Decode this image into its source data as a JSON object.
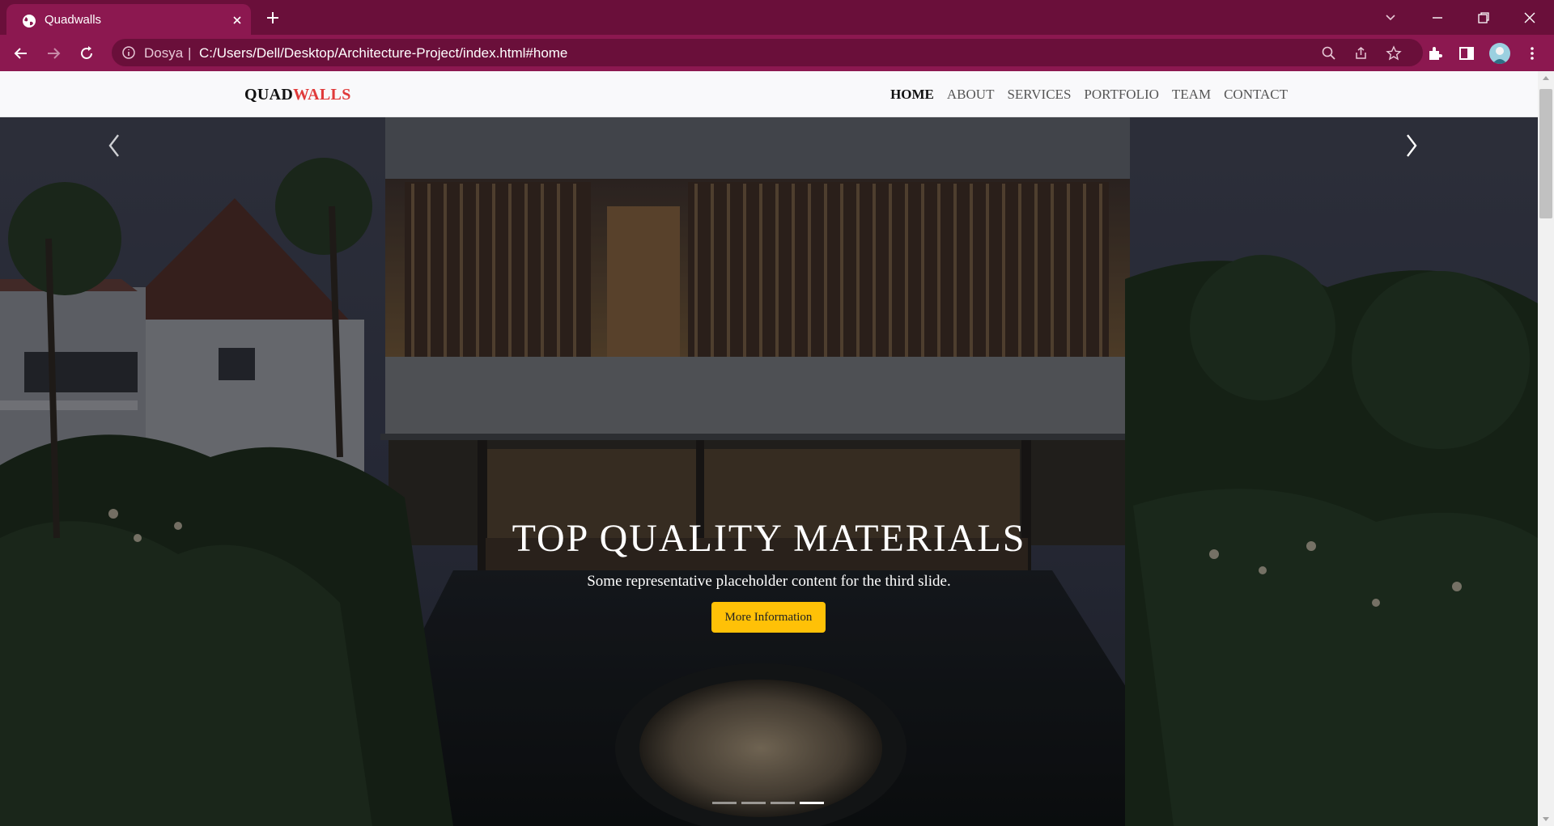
{
  "browser": {
    "tab_title": "Quadwalls",
    "site_label": "Dosya",
    "url": "C:/Users/Dell/Desktop/Architecture-Project/index.html#home"
  },
  "site": {
    "brand_part1": "QUAD",
    "brand_part2": "WALLS",
    "nav": [
      {
        "label": "HOME",
        "active": true
      },
      {
        "label": "ABOUT",
        "active": false
      },
      {
        "label": "SERVICES",
        "active": false
      },
      {
        "label": "PORTFOLIO",
        "active": false
      },
      {
        "label": "TEAM",
        "active": false
      },
      {
        "label": "CONTACT",
        "active": false
      }
    ]
  },
  "carousel": {
    "title": "TOP QUALITY MATERIALS",
    "text": "Some representative placeholder content for the third slide.",
    "button_label": "More Information",
    "slide_count": 4,
    "active_slide": 4
  },
  "colors": {
    "tabbar": "#6a0f3a",
    "toolbar": "#8c1850",
    "brand_accent": "#e03a3a",
    "button": "#ffc107"
  }
}
